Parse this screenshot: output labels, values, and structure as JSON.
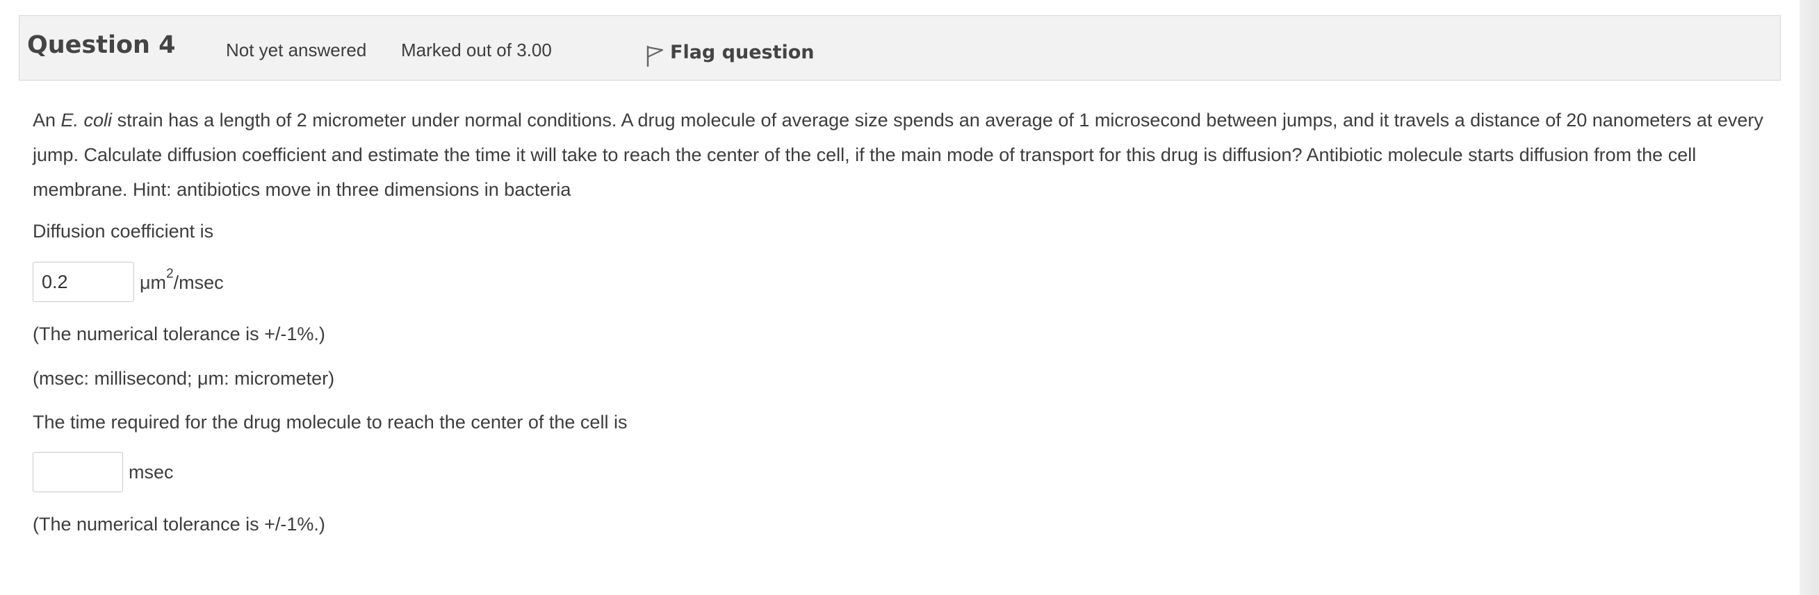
{
  "question": {
    "title": "Question 4",
    "state": "Not yet answered",
    "grade": "Marked out of 3.00",
    "flag_label": "Flag question",
    "flag_icon": "flag-outline-icon"
  },
  "text": {
    "lead": "An ",
    "organism": "E. coli",
    "body": " strain has a length of 2 micrometer under normal conditions. A drug molecule of average size spends an average of 1 microsecond between jumps, and it travels a distance of 20 nanometers at every jump. Calculate diffusion coefficient and estimate the time it will take to reach the center of the cell, if the main mode of transport for this drug is diffusion? Antibiotic molecule starts diffusion from the cell membrane. Hint: antibiotics move in three dimensions in bacteria"
  },
  "part1": {
    "prompt": "Diffusion coefficient is",
    "value": "0.2",
    "unit_base": "μm",
    "unit_exp": "2",
    "unit_rest": "/msec",
    "tolerance": "(The numerical tolerance is +/-1%.)",
    "note": "(msec: millisecond; μm: micrometer)"
  },
  "part2": {
    "prompt": "The time required for the drug molecule to reach the center of the cell is",
    "value": "",
    "unit": "msec",
    "tolerance": "(The numerical tolerance is +/-1%.)"
  }
}
